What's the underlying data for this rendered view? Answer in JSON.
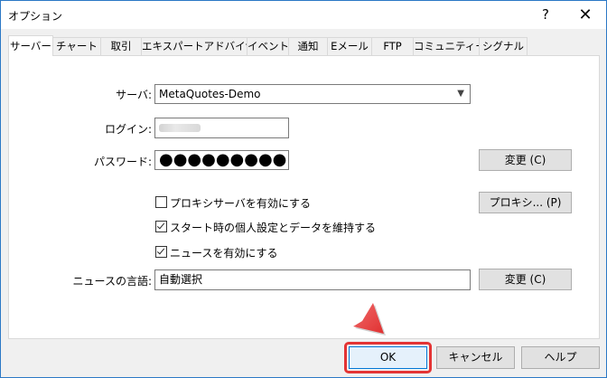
{
  "window": {
    "title": "オプション",
    "help_label": "?",
    "close_label": "✕"
  },
  "tabs": [
    {
      "label": "サーバー",
      "active": true
    },
    {
      "label": "チャート",
      "active": false
    },
    {
      "label": "取引",
      "active": false
    },
    {
      "label": "エキスパートアドバイザ",
      "active": false
    },
    {
      "label": "イベント",
      "active": false
    },
    {
      "label": "通知",
      "active": false
    },
    {
      "label": "Eメール",
      "active": false
    },
    {
      "label": "FTP",
      "active": false
    },
    {
      "label": "コミュニティー",
      "active": false
    },
    {
      "label": "シグナル",
      "active": false
    }
  ],
  "server": {
    "server_label": "サーバ:",
    "server_value": "MetaQuotes-Demo",
    "login_label": "ログイン:",
    "password_label": "パスワード:",
    "password_mask": "●●●●●●●●●",
    "change_password_button": "変更 (C)",
    "proxy_checkbox": {
      "label": "プロキシサーバを有効にする",
      "checked": false
    },
    "proxy_button": "プロキシ... (P)",
    "keep_settings_checkbox": {
      "label": "スタート時の個人設定とデータを維持する",
      "checked": true
    },
    "news_checkbox": {
      "label": "ニュースを有効にする",
      "checked": true
    },
    "news_lang_label": "ニュースの言語:",
    "news_lang_value": "自動選択",
    "change_lang_button": "変更 (C)"
  },
  "footer": {
    "ok_label": "OK",
    "cancel_label": "キャンセル",
    "help_label": "ヘルプ"
  },
  "colors": {
    "highlight": "#e43434",
    "ok_border": "#0078d7"
  }
}
